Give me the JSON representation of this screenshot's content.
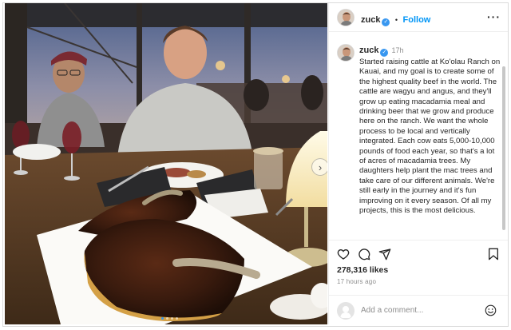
{
  "post": {
    "username": "zuck",
    "follow_label": "Follow",
    "separator": "•",
    "more_icon": "more-icon",
    "verified_mark": "✓",
    "time": "17h",
    "caption": "Started raising cattle at Ko'olau Ranch on Kauai, and my goal is to create some of the highest quality beef in the world. The cattle are wagyu and angus, and they'll grow up eating macadamia meal and drinking beer that we grow and produce here on the ranch. We want the whole process to be local and vertically integrated. Each cow eats 5,000-10,000 pounds of food each year, so that's a lot of acres of macadamia trees. My daughters help plant the mac trees and take care of our different animals. We're still early in the journey and it's fun improving on it every season. Of all my projects, this is the most delicious.",
    "likes": "278,316 likes",
    "posted_ago": "17 hours ago",
    "comment_placeholder": "Add a comment...",
    "carousel": {
      "total": 4,
      "active_index": 0
    }
  },
  "colors": {
    "accent": "#0095f6",
    "verified": "#3897f0",
    "text": "#262626",
    "muted": "#8e8e8e",
    "border": "#efefef"
  },
  "icons": [
    "heart-icon",
    "comment-icon",
    "share-icon",
    "bookmark-icon",
    "emoji-icon",
    "chevron-right-icon"
  ]
}
